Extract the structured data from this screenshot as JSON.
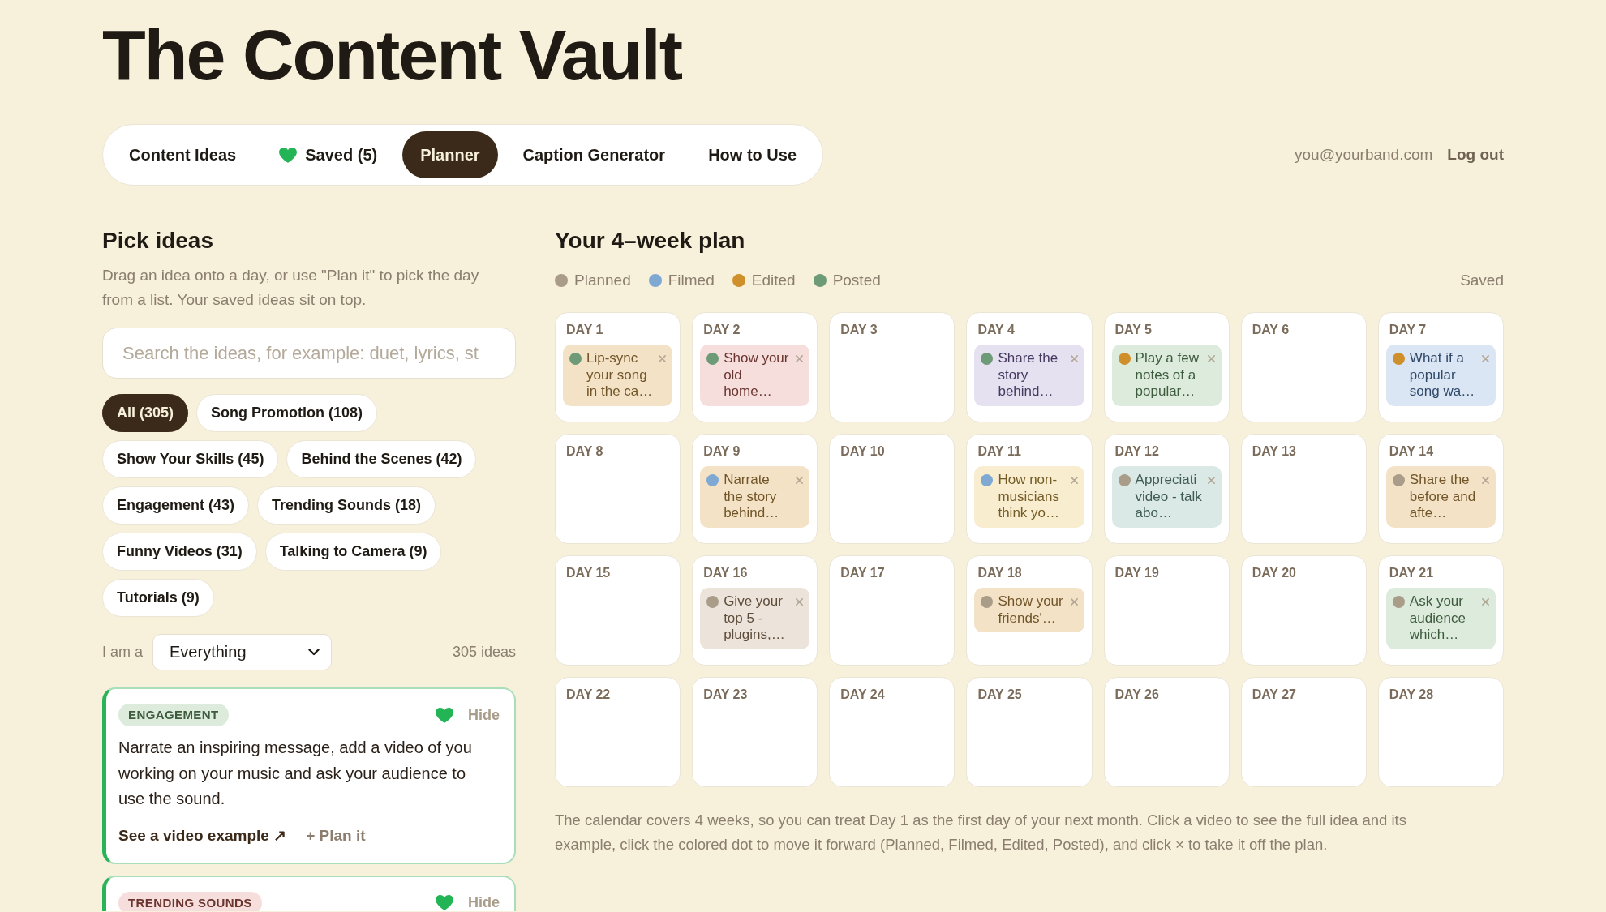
{
  "app": {
    "title": "The Content Vault"
  },
  "nav": {
    "tabs": [
      {
        "label": "Content Ideas",
        "selected": false,
        "kind": "text"
      },
      {
        "label": "Saved (5)",
        "selected": false,
        "kind": "heart"
      },
      {
        "label": "Planner",
        "selected": true,
        "kind": "text"
      },
      {
        "label": "Caption Generator",
        "selected": false,
        "kind": "text"
      },
      {
        "label": "How to Use",
        "selected": false,
        "kind": "text"
      }
    ]
  },
  "account": {
    "email": "you@yourband.com",
    "action": "Log out"
  },
  "picker": {
    "title": "Pick ideas",
    "description": "Drag an idea onto a day, or use \"Plan it\" to pick the day from a list. Your saved ideas sit on top.",
    "search": {
      "placeholder": "Search the ideas, for example: duet, lyrics, st"
    },
    "filters": [
      {
        "label": "All (305)",
        "selected": true
      },
      {
        "label": "Song Promotion (108)",
        "selected": false
      },
      {
        "label": "Show Your Skills (45)",
        "selected": false
      },
      {
        "label": "Behind the Scenes (42)",
        "selected": false
      },
      {
        "label": "Engagement (43)",
        "selected": false
      },
      {
        "label": "Trending Sounds (18)",
        "selected": false
      },
      {
        "label": "Funny Videos (31)",
        "selected": false
      },
      {
        "label": "Talking to Camera (9)",
        "selected": false
      },
      {
        "label": "Tutorials (9)",
        "selected": false
      }
    ],
    "role_filter": {
      "label": "I am a",
      "value": "Everything"
    },
    "count": "305 ideas",
    "ideas": [
      {
        "tag": "ENGAGEMENT",
        "color": "#dcebdc",
        "saved": true,
        "hide": "Hide",
        "text": "Narrate an inspiring message, add a video of you working on your music and ask your audience to use the sound.",
        "link": "See a video example ↗",
        "plan": "+ Plan it"
      },
      {
        "tag": "TRENDING SOUNDS",
        "color": "#f5dedc",
        "saved": true,
        "hide": "Hide"
      }
    ]
  },
  "planner": {
    "title": "Your 4–week plan",
    "legend": [
      {
        "kind": "planned",
        "label": "Planned",
        "color": "#a99c89"
      },
      {
        "kind": "filmed",
        "label": "Filmed",
        "color": "#7fa8d3"
      },
      {
        "kind": "edited",
        "label": "Edited",
        "color": "#cf8f2a"
      },
      {
        "kind": "posted",
        "label": "Posted",
        "color": "#6e9b77"
      }
    ],
    "save_status": "Saved",
    "days": [
      {
        "label": "DAY 1",
        "entries": [
          {
            "text": "Lip-sync your song in the ca…",
            "kind": "posted",
            "color": "#f4e2c6"
          }
        ]
      },
      {
        "label": "DAY 2",
        "entries": [
          {
            "text": "Show your old home…",
            "kind": "posted",
            "color": "#f5dedc"
          }
        ]
      },
      {
        "label": "DAY 3"
      },
      {
        "label": "DAY 4",
        "entries": [
          {
            "text": "Share the story behind…",
            "kind": "posted",
            "color": "#e6e1f1"
          }
        ]
      },
      {
        "label": "DAY 5",
        "entries": [
          {
            "text": "Play a few notes of a popular…",
            "kind": "edited",
            "color": "#dcebdc"
          }
        ]
      },
      {
        "label": "DAY 6"
      },
      {
        "label": "DAY 7",
        "entries": [
          {
            "text": "What if a popular song wa…",
            "kind": "edited",
            "color": "#dbe6f4"
          }
        ]
      },
      {
        "label": "DAY 8"
      },
      {
        "label": "DAY 9",
        "entries": [
          {
            "text": "Narrate the story behind…",
            "kind": "filmed",
            "color": "#f4e2c6"
          }
        ]
      },
      {
        "label": "DAY 10"
      },
      {
        "label": "DAY 11",
        "entries": [
          {
            "text": "How non-musicians think yo…",
            "kind": "filmed",
            "color": "#f9edd0"
          }
        ]
      },
      {
        "label": "DAY 12",
        "entries": [
          {
            "text": "Appreciati video - talk abo…",
            "kind": "planned",
            "color": "#dbe9e6"
          }
        ]
      },
      {
        "label": "DAY 13"
      },
      {
        "label": "DAY 14",
        "entries": [
          {
            "text": "Share the before and afte…",
            "kind": "planned",
            "color": "#f4e2c6"
          }
        ]
      },
      {
        "label": "DAY 15"
      },
      {
        "label": "DAY 16",
        "entries": [
          {
            "text": "Give your top 5 - plugins,…",
            "kind": "planned",
            "color": "#ece3da"
          }
        ]
      },
      {
        "label": "DAY 17"
      },
      {
        "label": "DAY 18",
        "entries": [
          {
            "text": "Show your friends'…",
            "kind": "planned",
            "color": "#f4e2c6"
          }
        ]
      },
      {
        "label": "DAY 19"
      },
      {
        "label": "DAY 20"
      },
      {
        "label": "DAY 21",
        "entries": [
          {
            "text": "Ask your audience which…",
            "kind": "planned",
            "color": "#dcebdc"
          }
        ]
      },
      {
        "label": "DAY 22"
      },
      {
        "label": "DAY 23"
      },
      {
        "label": "DAY 24"
      },
      {
        "label": "DAY 25"
      },
      {
        "label": "DAY 26"
      },
      {
        "label": "DAY 27"
      },
      {
        "label": "DAY 28"
      }
    ],
    "note": "The calendar covers 4 weeks, so you can treat Day 1 as the first day of your next month. Click a video to see the full idea and its example, click the colored dot to move it forward (Planned, Filmed, Edited, Posted), and click × to take it off the plan."
  }
}
